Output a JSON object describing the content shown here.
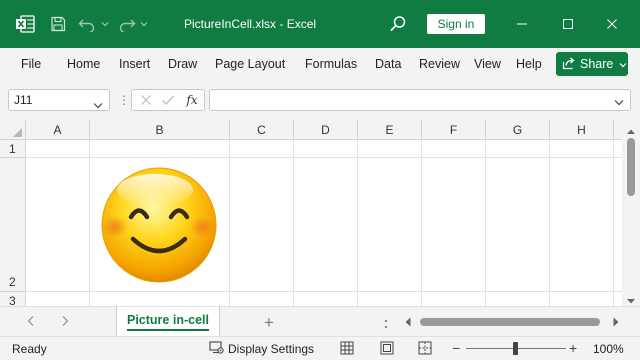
{
  "titlebar": {
    "document_title": "PictureInCell.xlsx  -  Excel",
    "sign_in_label": "Sign in"
  },
  "ribbon": {
    "tabs": [
      "File",
      "Home",
      "Insert",
      "Draw",
      "Page Layout",
      "Formulas",
      "Data",
      "Review",
      "View",
      "Help"
    ],
    "share_label": "Share"
  },
  "formula_bar": {
    "name_box": "J11",
    "fx_label": "fx",
    "formula": ""
  },
  "grid": {
    "columns": [
      "A",
      "B",
      "C",
      "D",
      "E",
      "F",
      "G",
      "H"
    ],
    "rows": [
      "1",
      "2",
      "3"
    ],
    "picture_cell": {
      "cell": "B2",
      "content": "smiley-face-icon"
    }
  },
  "sheets": {
    "tabs": [
      "Picture in-cell"
    ],
    "active": "Picture in-cell",
    "add_label": "+"
  },
  "statusbar": {
    "status": "Ready",
    "display_settings_label": "Display Settings",
    "zoom_level": "100%",
    "zoom_out_label": "−",
    "zoom_in_label": "+"
  },
  "colors": {
    "excel_green": "#107c41",
    "ribbon_bg": "#f3f3f3",
    "gridline": "#e1e1e1"
  }
}
